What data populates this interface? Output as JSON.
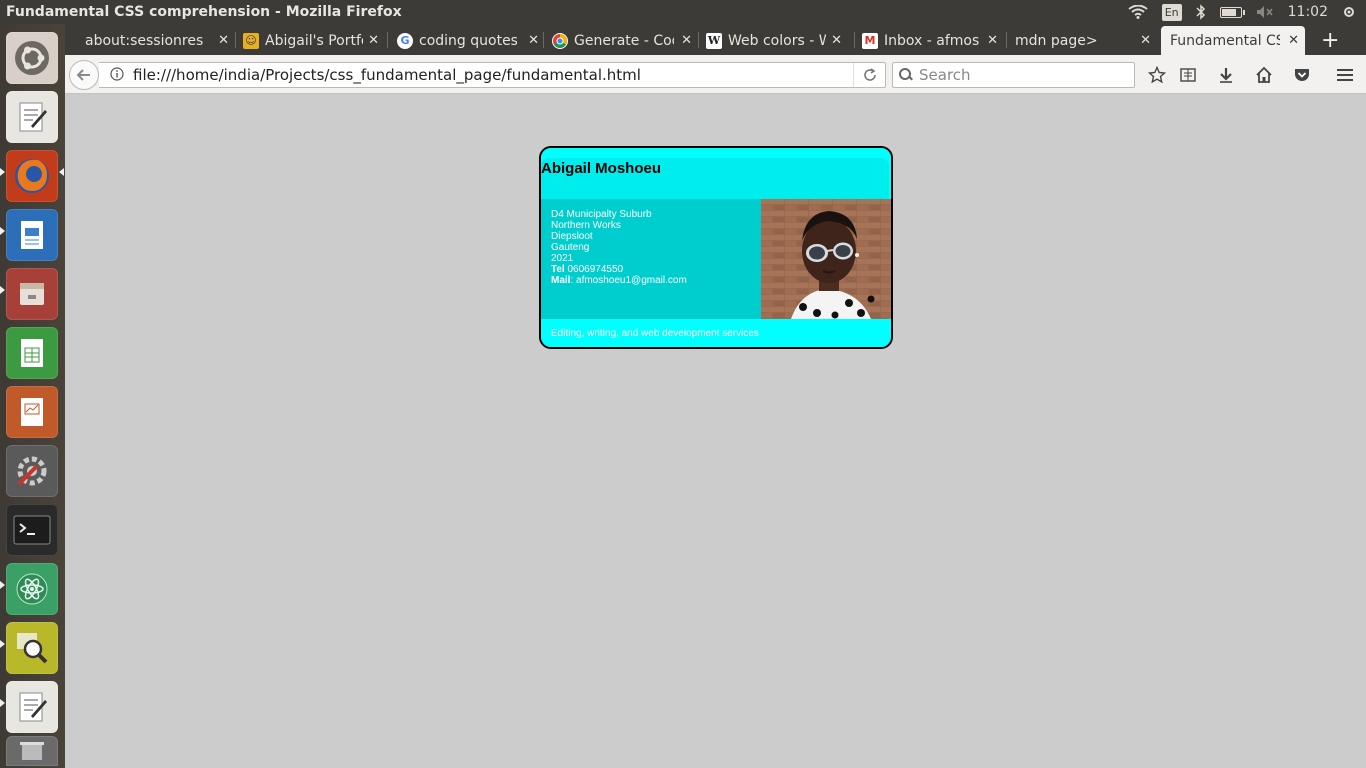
{
  "window": {
    "title": "Fundamental CSS comprehension - Mozilla Firefox",
    "keyboard_layout": "En",
    "clock": "11:02",
    "battery_level": 0.8
  },
  "tabs": [
    {
      "title": "about:sessionrestore",
      "favicon": "blank"
    },
    {
      "title": "Abigail's Portfolio",
      "favicon": "portfolio-icon"
    },
    {
      "title": "coding quotes",
      "favicon": "google-icon"
    },
    {
      "title": "Generate - Code",
      "favicon": "google-chrome-icon"
    },
    {
      "title": "Web colors - W",
      "favicon": "wikipedia-icon"
    },
    {
      "title": "Inbox - afmoshoeu",
      "favicon": "gmail-icon"
    },
    {
      "title": "mdn page>",
      "favicon": "blank"
    },
    {
      "title": "Fundamental CSS comprehension",
      "favicon": "blank",
      "active": true
    }
  ],
  "navbar": {
    "url": "file:///home/india/Projects/css_fundamental_page/fundamental.html",
    "search_placeholder": "Search"
  },
  "card": {
    "name": "Abigail Moshoeu",
    "address": [
      "D4 Municipalty Suburb",
      "Northern Works",
      "Diepsloot",
      "Gauteng",
      "2021"
    ],
    "tel_label": "Tel",
    "tel": "0606974550",
    "mail_label": "Mail",
    "mail": "afmoshoeu1@gmail.com",
    "tagline": "Editing, writing, and web development services"
  },
  "colors": {
    "card_header": "#00ffff",
    "card_body": "#00cece",
    "page_bg": "#cccccc"
  }
}
